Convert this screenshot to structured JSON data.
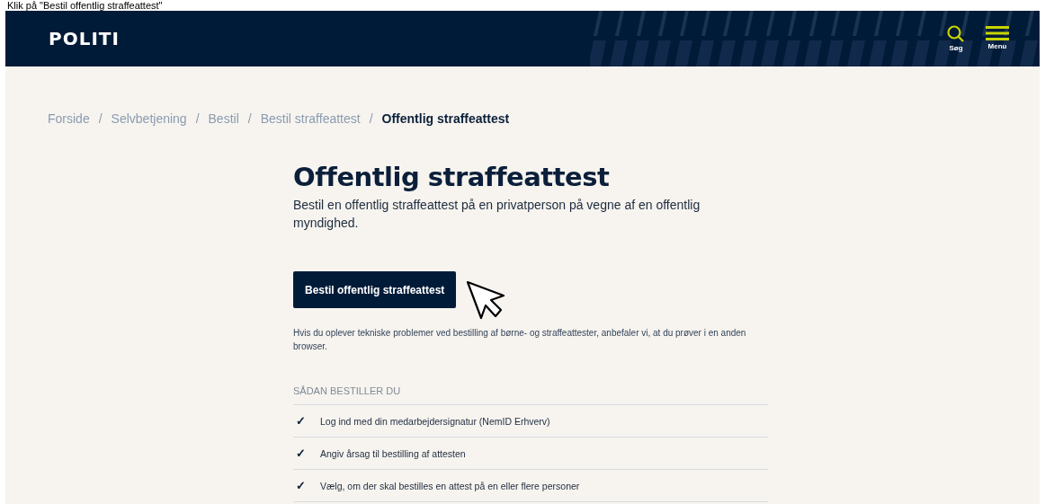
{
  "caption": "Klik på \"Bestil offentlig straffeattest\"",
  "header": {
    "logo": "POLITI",
    "actions": [
      {
        "kind": "search",
        "label": "Søg"
      },
      {
        "kind": "menu",
        "label": "Menu"
      }
    ]
  },
  "breadcrumbs": [
    {
      "label": "Forside",
      "current": false
    },
    {
      "label": "Selvbetjening",
      "current": false
    },
    {
      "label": "Bestil",
      "current": false
    },
    {
      "label": "Bestil straffeattest",
      "current": false
    },
    {
      "label": "Offentlig straffeattest",
      "current": true
    }
  ],
  "breadcrumb_separator": "/",
  "title": "Offentlig straffeattest",
  "intro": "Bestil en offentlig straffeattest på en privatperson på vegne af en offentlig myndighed.",
  "order_button": "Bestil offentlig straffeattest",
  "notice": "Hvis du oplever tekniske problemer ved bestilling af børne- og straffeattester, anbefaler vi, at du prøver i en anden browser.",
  "steps_heading": "SÅDAN BESTILLER DU",
  "steps": [
    {
      "mark": "✓",
      "text": "Log ind med din medarbejdersignatur (NemID Erhverv)"
    },
    {
      "mark": "✓",
      "text": "Angiv årsag til bestilling af attesten"
    },
    {
      "mark": "✓",
      "text": "Vælg, om der skal bestilles en attest på en eller flere personer"
    }
  ]
}
